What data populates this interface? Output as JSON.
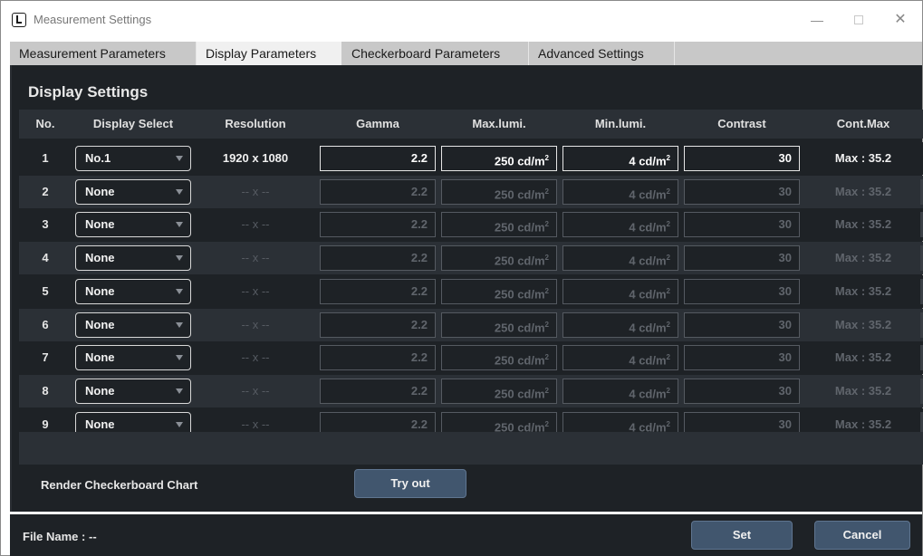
{
  "window": {
    "title": "Measurement Settings",
    "icon": "app-logo-icon",
    "controls": {
      "minimize": "—",
      "close": "✕"
    }
  },
  "tabs": [
    {
      "label": "Measurement Parameters",
      "active": false
    },
    {
      "label": "Display Parameters",
      "active": true
    },
    {
      "label": "Checkerboard Parameters",
      "active": false
    },
    {
      "label": "Advanced Settings",
      "active": false
    }
  ],
  "section_title": "Display Settings",
  "columns": [
    "No.",
    "Display Select",
    "Resolution",
    "Gamma",
    "Max.lumi.",
    "Min.lumi.",
    "Contrast",
    "Cont.Max"
  ],
  "units": {
    "lumi": "cd/m",
    "lumi_sup": "2"
  },
  "rows": [
    {
      "no": "1",
      "display": "No.1",
      "resolution": "1920 x 1080",
      "gamma": "2.2",
      "max_lumi": "250",
      "min_lumi": "4",
      "contrast": "30",
      "cont_max": "Max : 35.2",
      "enabled": true
    },
    {
      "no": "2",
      "display": "None",
      "resolution": "-- x --",
      "gamma": "2.2",
      "max_lumi": "250",
      "min_lumi": "4",
      "contrast": "30",
      "cont_max": "Max : 35.2",
      "enabled": false
    },
    {
      "no": "3",
      "display": "None",
      "resolution": "-- x --",
      "gamma": "2.2",
      "max_lumi": "250",
      "min_lumi": "4",
      "contrast": "30",
      "cont_max": "Max : 35.2",
      "enabled": false
    },
    {
      "no": "4",
      "display": "None",
      "resolution": "-- x --",
      "gamma": "2.2",
      "max_lumi": "250",
      "min_lumi": "4",
      "contrast": "30",
      "cont_max": "Max : 35.2",
      "enabled": false
    },
    {
      "no": "5",
      "display": "None",
      "resolution": "-- x --",
      "gamma": "2.2",
      "max_lumi": "250",
      "min_lumi": "4",
      "contrast": "30",
      "cont_max": "Max : 35.2",
      "enabled": false
    },
    {
      "no": "6",
      "display": "None",
      "resolution": "-- x --",
      "gamma": "2.2",
      "max_lumi": "250",
      "min_lumi": "4",
      "contrast": "30",
      "cont_max": "Max : 35.2",
      "enabled": false
    },
    {
      "no": "7",
      "display": "None",
      "resolution": "-- x --",
      "gamma": "2.2",
      "max_lumi": "250",
      "min_lumi": "4",
      "contrast": "30",
      "cont_max": "Max : 35.2",
      "enabled": false
    },
    {
      "no": "8",
      "display": "None",
      "resolution": "-- x --",
      "gamma": "2.2",
      "max_lumi": "250",
      "min_lumi": "4",
      "contrast": "30",
      "cont_max": "Max : 35.2",
      "enabled": false
    },
    {
      "no": "9",
      "display": "None",
      "resolution": "-- x --",
      "gamma": "2.2",
      "max_lumi": "250",
      "min_lumi": "4",
      "contrast": "30",
      "cont_max": "Max : 35.2",
      "enabled": false
    }
  ],
  "render_checkerboard": {
    "label": "Render Checkerboard Chart",
    "button": "Try out"
  },
  "footer": {
    "file_name_label": "File Name :",
    "file_name_value": "--",
    "set_button": "Set",
    "cancel_button": "Cancel"
  },
  "colors": {
    "panel_bg": "#1e2226",
    "row_alt_bg": "#2b3036",
    "button_bg": "#41566e",
    "tab_bar_bg": "#c8c8c8"
  }
}
